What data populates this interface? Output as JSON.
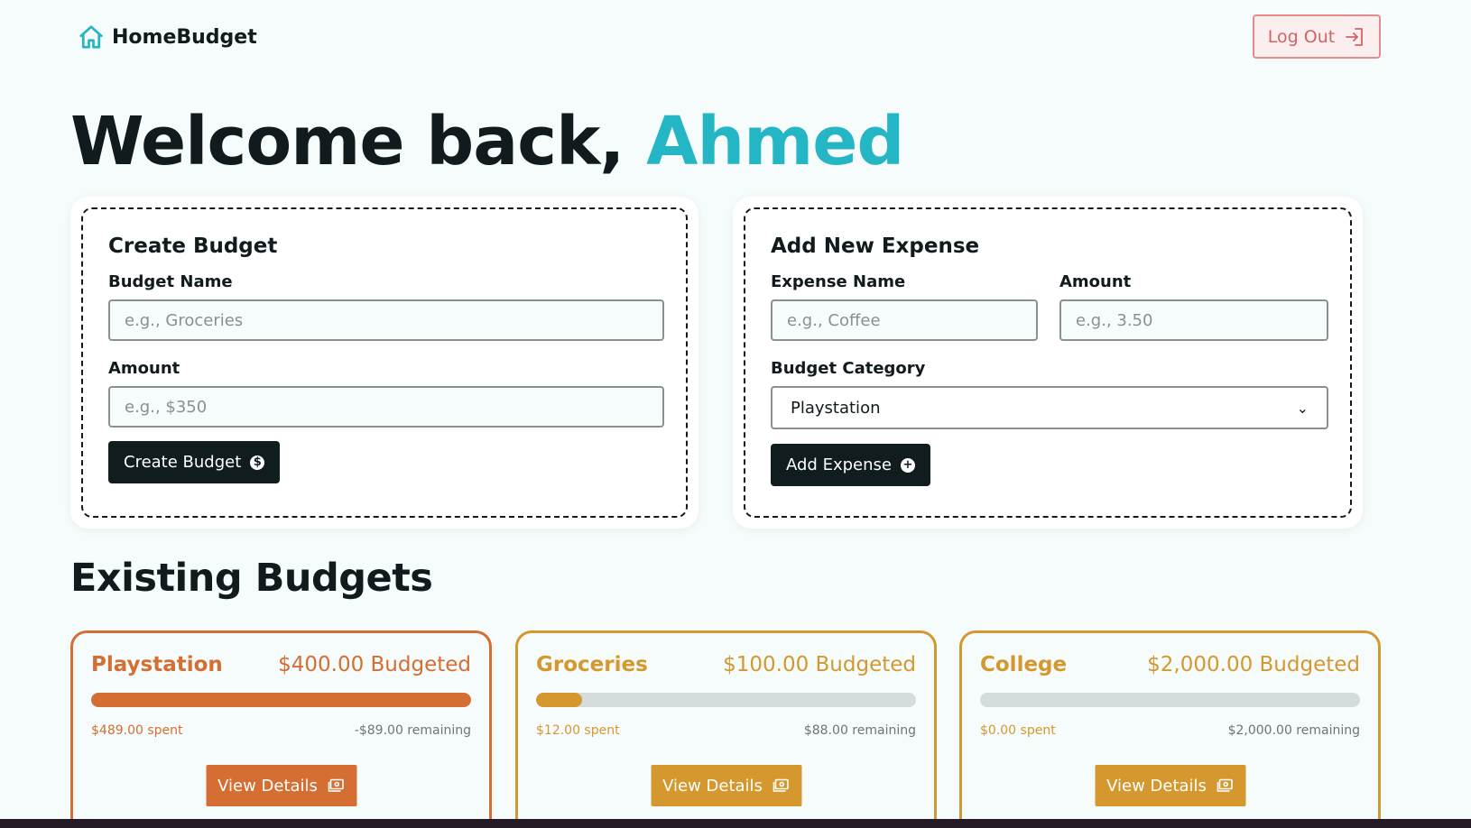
{
  "app": {
    "name": "HomeBudget"
  },
  "nav": {
    "logout_label": "Log Out",
    "logout_icon": "logout-icon"
  },
  "welcome": {
    "prefix": "Welcome back, ",
    "username": "Ahmed"
  },
  "create_budget": {
    "title": "Create Budget",
    "name_label": "Budget Name",
    "name_placeholder": "e.g., Groceries",
    "amount_label": "Amount",
    "amount_placeholder": "e.g., $350",
    "button_label": "Create Budget"
  },
  "add_expense": {
    "title": "Add New Expense",
    "name_label": "Expense Name",
    "name_placeholder": "e.g., Coffee",
    "amount_label": "Amount",
    "amount_placeholder": "e.g., 3.50",
    "category_label": "Budget Category",
    "category_selected": "Playstation",
    "button_label": "Add Expense"
  },
  "existing": {
    "title": "Existing Budgets",
    "budgets": [
      {
        "name": "Playstation",
        "budgeted": "$400.00 Budgeted",
        "spent": "$489.00 spent",
        "remaining": "-$89.00 remaining",
        "progress": 1.0,
        "color": "#d56e33",
        "button_label": "View Details"
      },
      {
        "name": "Groceries",
        "budgeted": "$100.00 Budgeted",
        "spent": "$12.00 spent",
        "remaining": "$88.00 remaining",
        "progress": 0.12,
        "color": "#d4982f",
        "button_label": "View Details"
      },
      {
        "name": "College",
        "budgeted": "$2,000.00 Budgeted",
        "spent": "$0.00 spent",
        "remaining": "$2,000.00 remaining",
        "progress": 0.0,
        "color": "#d4982f",
        "button_label": "View Details"
      }
    ]
  },
  "colors": {
    "accent": "#25b6c6",
    "dark": "#101c1e",
    "logout": "#d06464"
  }
}
